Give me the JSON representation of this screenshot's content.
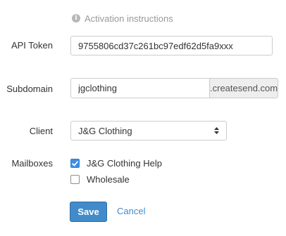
{
  "info": {
    "link_text": "Activation instructions",
    "icon": "info-circle-icon"
  },
  "form": {
    "api_token": {
      "label": "API Token",
      "value": "9755806cd37c261bc97edf62d5fa9xxx"
    },
    "subdomain": {
      "label": "Subdomain",
      "value": "jgclothing",
      "suffix": ".createsend.com"
    },
    "client": {
      "label": "Client",
      "selected": "J&G Clothing"
    },
    "mailboxes": {
      "label": "Mailboxes",
      "options": [
        {
          "label": "J&G Clothing Help",
          "checked": true
        },
        {
          "label": "Wholesale",
          "checked": false
        }
      ]
    }
  },
  "actions": {
    "save_label": "Save",
    "cancel_label": "Cancel"
  },
  "colors": {
    "primary": "#428bca",
    "checkbox_checked": "#3d8fe6",
    "addon_bg": "#eeeeee",
    "muted_text": "#999999"
  }
}
